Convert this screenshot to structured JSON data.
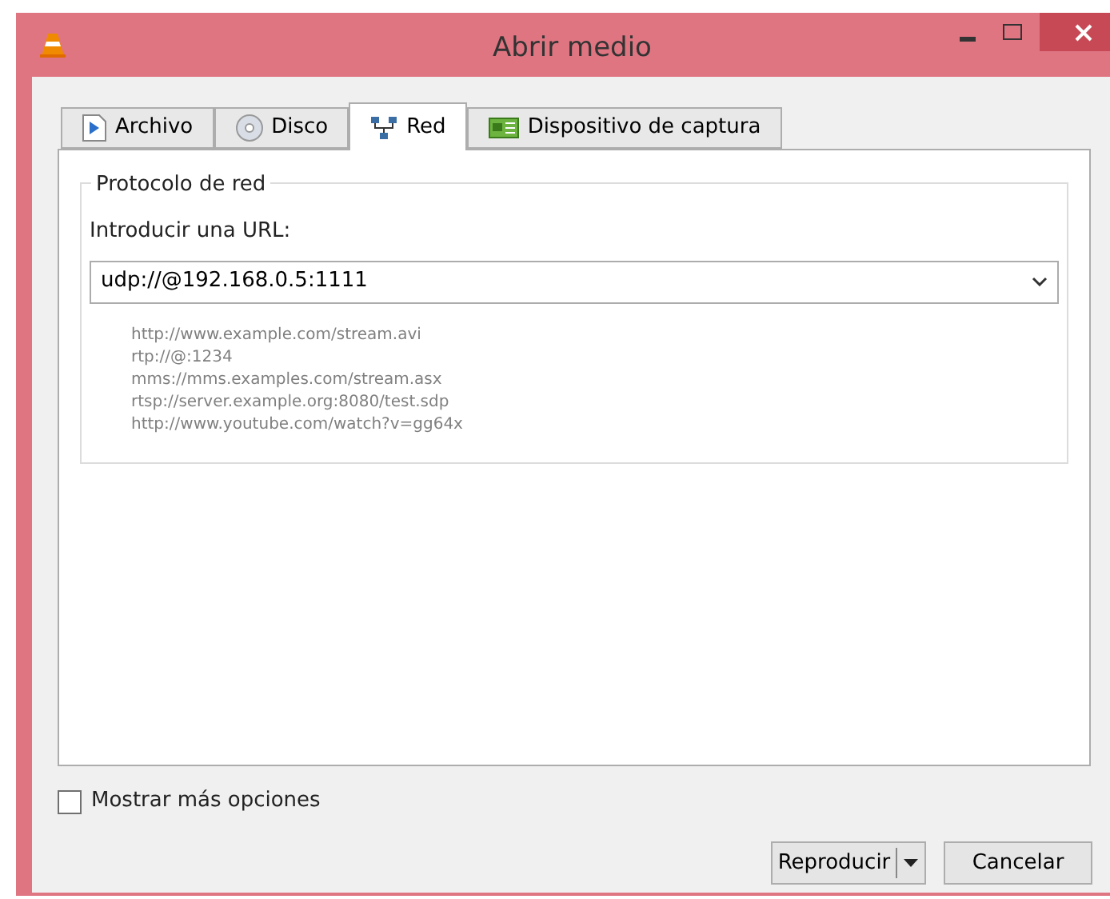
{
  "window": {
    "title": "Abrir medio"
  },
  "tabs": [
    {
      "label": "Archivo",
      "kind": "file",
      "selected": false
    },
    {
      "label": "Disco",
      "kind": "disc",
      "selected": false
    },
    {
      "label": "Red",
      "kind": "network",
      "selected": true
    },
    {
      "label": "Dispositivo de captura",
      "kind": "capture",
      "selected": false
    }
  ],
  "group": {
    "title": "Protocolo de red",
    "url_label": "Introducir una URL:",
    "url_value": "udp://@192.168.0.5:1111",
    "examples": [
      "http://www.example.com/stream.avi",
      "rtp://@:1234",
      "mms://mms.examples.com/stream.asx",
      "rtsp://server.example.org:8080/test.sdp",
      "http://www.youtube.com/watch?v=gg64x"
    ]
  },
  "more_options": {
    "label": "Mostrar más opciones",
    "checked": false
  },
  "buttons": [
    {
      "label": "Reproducir",
      "kind": "split"
    },
    {
      "label": "Cancelar",
      "kind": "plain"
    }
  ]
}
